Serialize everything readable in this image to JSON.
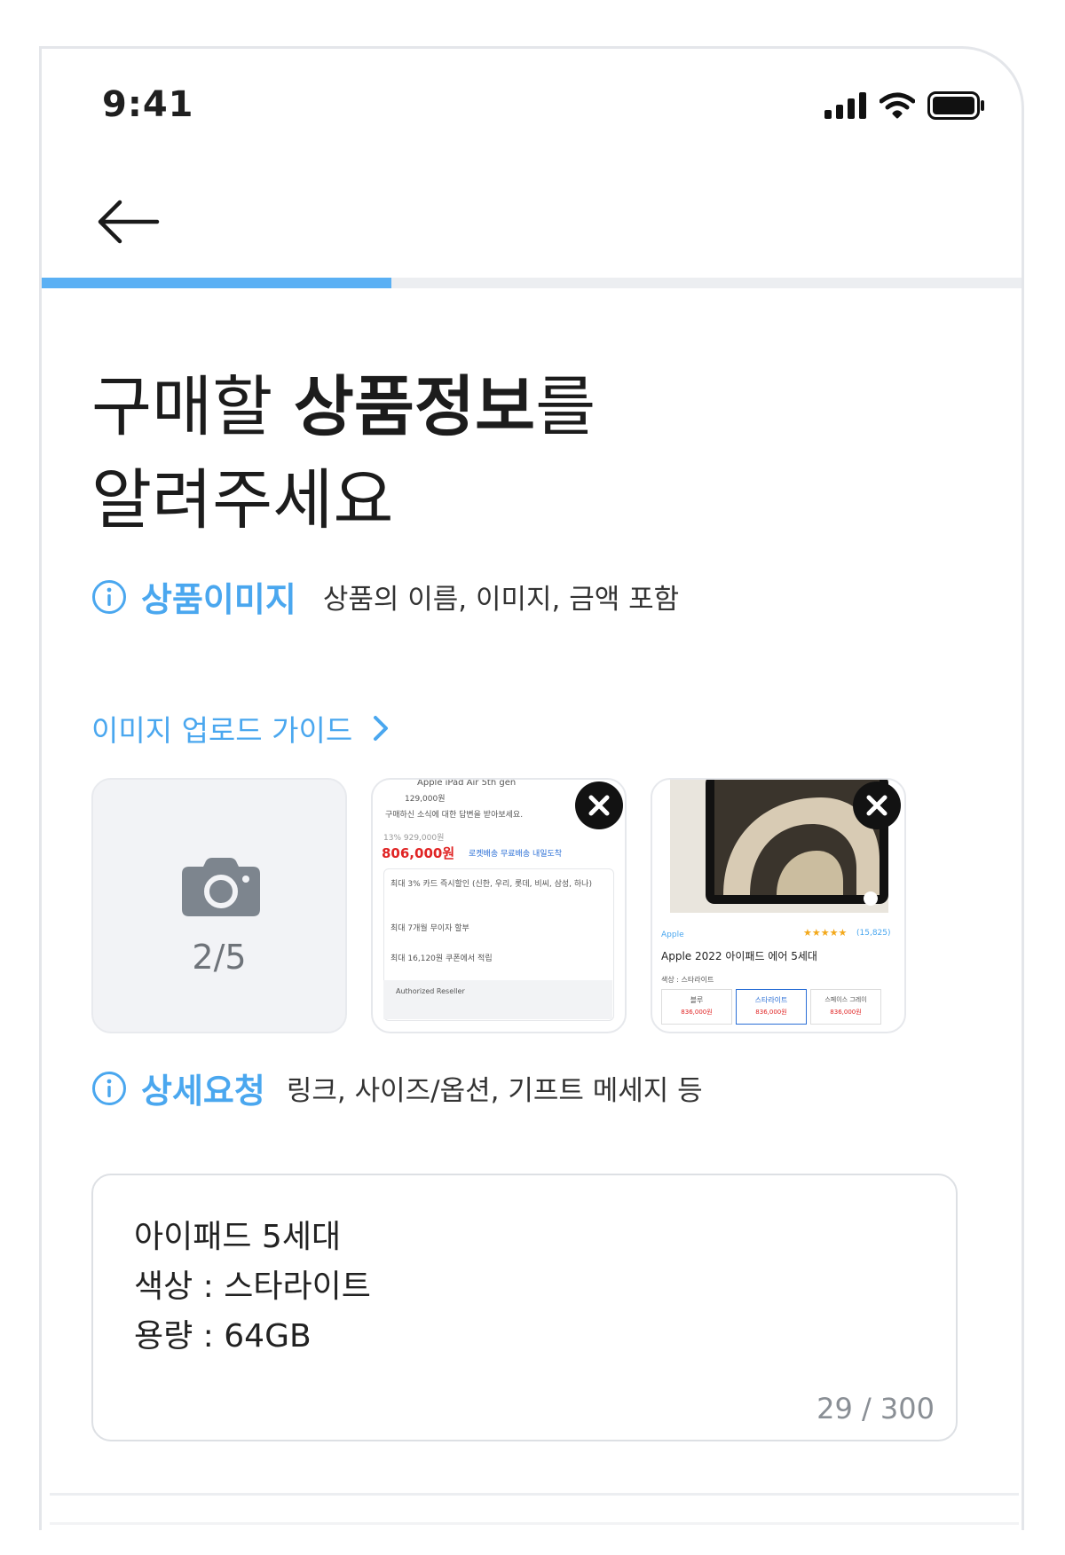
{
  "status_bar": {
    "time": "9:41"
  },
  "progress": {
    "fraction": 0.357
  },
  "heading": {
    "line1_pre": "구매할 ",
    "line1_bold": "상품정보",
    "line1_post": "를",
    "line2": "알려주세요"
  },
  "image_section": {
    "label": "상품이미지",
    "description": "상품의 이름, 이미지, 금액 포함",
    "guide_link": "이미지 업로드 가이드",
    "upload_count": "2/5",
    "screenshot1": {
      "header": "Apple iPad Air 5th gen",
      "price_old": "129,000원",
      "notice": "구매하신 소식에 대한 답변을 받아보세요.",
      "discount": "13% 929,000원",
      "price": "806,000원",
      "shipping": "로켓배송 무료배송 내일도착",
      "card_benefit": "최대 3% 카드 즉시할인 (신한, 우리, 롯데, 비씨, 삼성, 하나)",
      "installment": "최대 7개월 무이자 할부",
      "coupon": "최대 16,120원 쿠폰에서 적립",
      "seller": "Authorized Reseller"
    },
    "screenshot2": {
      "brand": "Apple",
      "rating": "★★★★★",
      "reviews": "(15,825)",
      "name": "Apple 2022 아이패드 에어 5세대",
      "color_label": "색상 : 스타라이트",
      "options": [
        {
          "name": "블루",
          "price": "836,000원"
        },
        {
          "name": "스타라이트",
          "price": "836,000원"
        },
        {
          "name": "스페이스 그레이",
          "price": "836,000원"
        }
      ]
    }
  },
  "detail_section": {
    "label": "상세요청",
    "description": "링크, 사이즈/옵션, 기프트 메세지 등",
    "text_lines": [
      "아이패드 5세대",
      "색상 : 스타라이트",
      "용량 : 64GB"
    ],
    "counter": "29 / 300"
  },
  "colors": {
    "accent": "#4aa7ef",
    "progress": "#5ab0f4",
    "price_red": "#e02424"
  },
  "icons": [
    "cellular-icon",
    "wifi-icon",
    "battery-icon",
    "back-arrow-icon",
    "info-icon",
    "chevron-right-icon",
    "camera-icon",
    "close-icon"
  ]
}
